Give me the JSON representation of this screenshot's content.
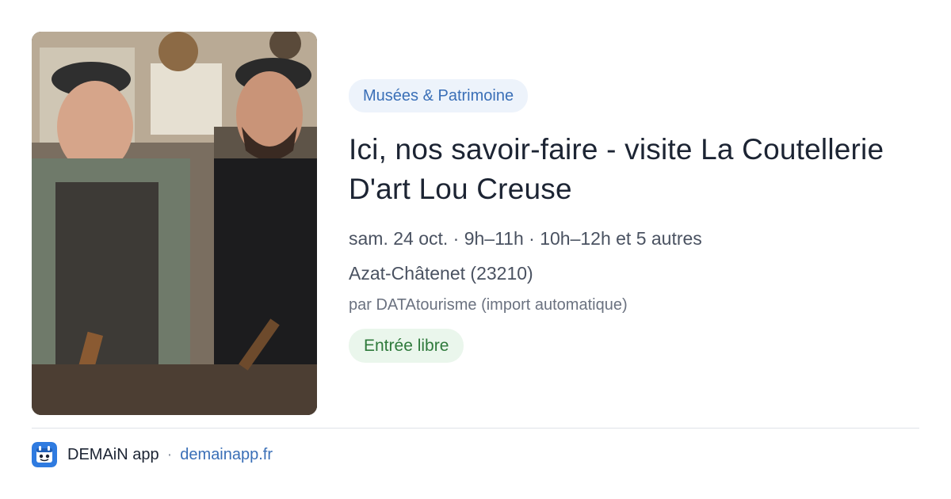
{
  "card": {
    "image": {
      "alt_icon": "photo-of-two-cutlers-in-workshop"
    },
    "category": "Musées & Patrimoine",
    "title": "Ici, nos savoir-faire - visite La Coutellerie D'art Lou Creuse",
    "schedule": "sam. 24 oct. · 9h–11h · 10h–12h et 5 autres",
    "location": "Azat-Châtenet (23210)",
    "source": "par DATAtourisme (import automatique)",
    "price": "Entrée libre"
  },
  "footer": {
    "app_name": "DEMAiN app",
    "separator": "·",
    "domain": "demainapp.fr",
    "logo_icon": "demain-app-logo-icon"
  },
  "colors": {
    "category_bg": "#edf3fb",
    "category_text": "#3a6fb7",
    "price_bg": "#eaf6ec",
    "price_text": "#2f7a3c",
    "title_text": "#1c2433",
    "link": "#3a6fb7",
    "logo_blue": "#2f7be0"
  }
}
